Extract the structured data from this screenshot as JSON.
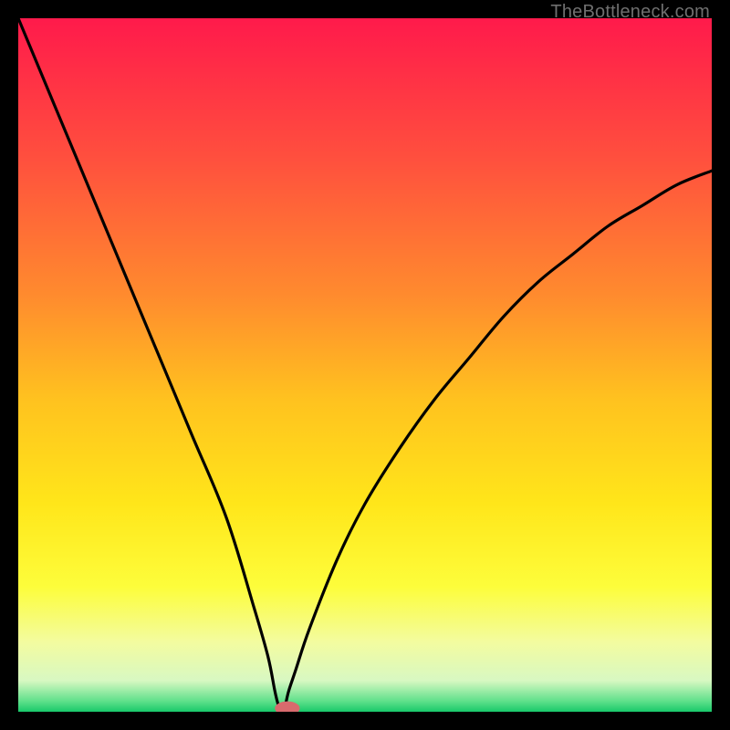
{
  "watermark": "TheBottleneck.com",
  "chart_data": {
    "type": "line",
    "title": "",
    "xlabel": "",
    "ylabel": "",
    "xlim": [
      0,
      100
    ],
    "ylim": [
      0,
      100
    ],
    "grid": false,
    "legend": false,
    "notch_x": 38,
    "series": [
      {
        "name": "bottleneck-curve",
        "x": [
          0,
          5,
          10,
          15,
          20,
          25,
          30,
          34,
          36,
          37,
          37.5,
          38,
          38.5,
          39,
          40,
          42,
          46,
          50,
          55,
          60,
          65,
          70,
          75,
          80,
          85,
          90,
          95,
          100
        ],
        "values": [
          100,
          88,
          76,
          64,
          52,
          40,
          28,
          15,
          8,
          3,
          1,
          0.3,
          1,
          3,
          6,
          12,
          22,
          30,
          38,
          45,
          51,
          57,
          62,
          66,
          70,
          73,
          76,
          78
        ]
      }
    ],
    "background_gradient": {
      "stops": [
        {
          "offset": 0.0,
          "color": "#ff1a4b"
        },
        {
          "offset": 0.2,
          "color": "#ff4f3e"
        },
        {
          "offset": 0.4,
          "color": "#ff8b2e"
        },
        {
          "offset": 0.55,
          "color": "#ffc21f"
        },
        {
          "offset": 0.7,
          "color": "#ffe61a"
        },
        {
          "offset": 0.82,
          "color": "#fdfd3b"
        },
        {
          "offset": 0.9,
          "color": "#f3fca0"
        },
        {
          "offset": 0.955,
          "color": "#d8f8c2"
        },
        {
          "offset": 0.985,
          "color": "#5ee08a"
        },
        {
          "offset": 1.0,
          "color": "#18c96a"
        }
      ]
    },
    "marker": {
      "x": 38.8,
      "y": 0.5,
      "rx": 1.8,
      "ry": 1.0,
      "color": "#d86a6d"
    }
  }
}
